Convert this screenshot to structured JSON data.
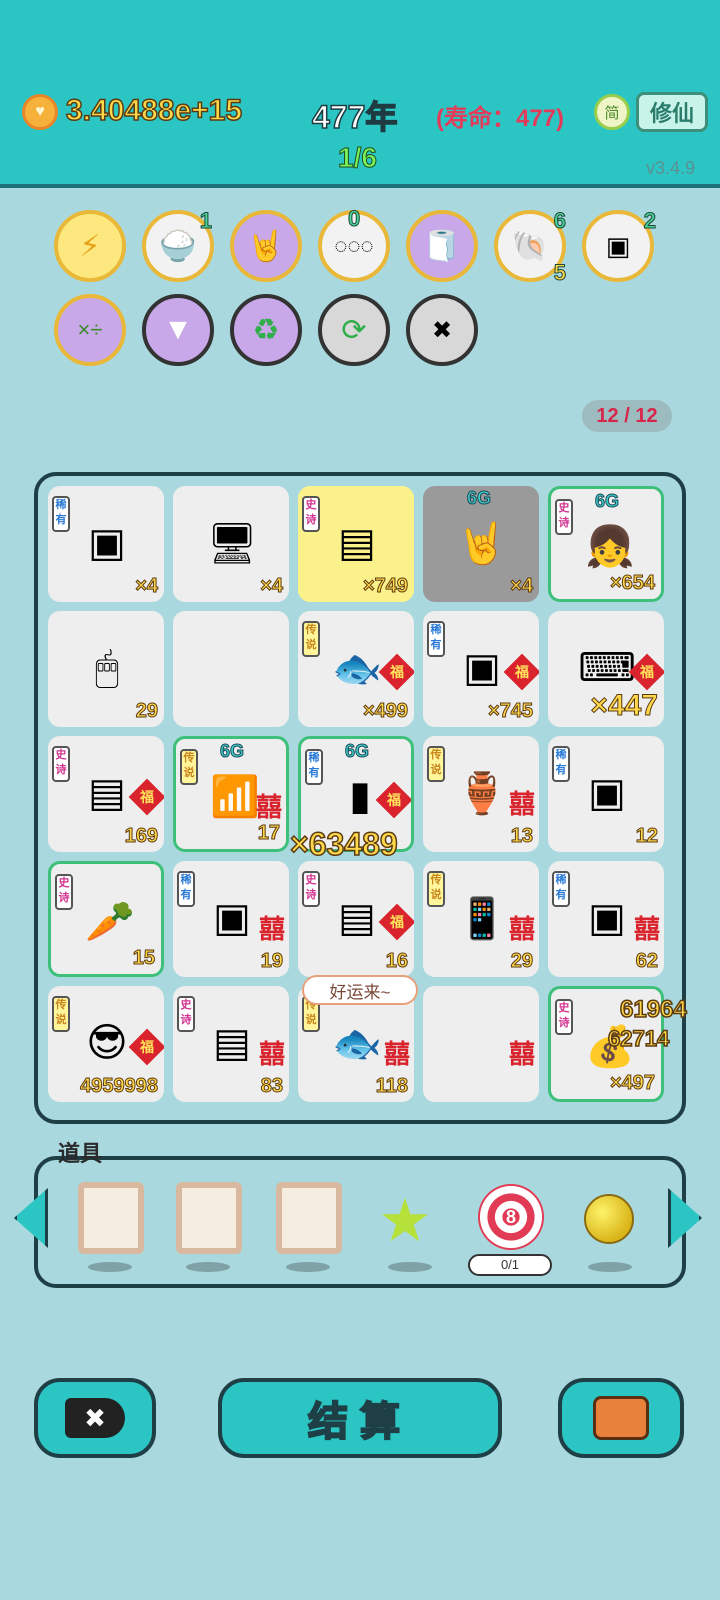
{
  "status_bar": {
    "coins": "3.40488e+15",
    "years": "477年",
    "lifespan": "(寿命：477)",
    "stage": "1/6",
    "lang_button": "简",
    "cultivate_button": "修仙",
    "version": "v3.4.9"
  },
  "skills_row1": [
    {
      "icon": "lightning-icon",
      "count": ""
    },
    {
      "icon": "rice-bowl-icon",
      "count": "1"
    },
    {
      "icon": "rock-hand-icon",
      "count": ""
    },
    {
      "icon": "egg-tray-icon",
      "count": "0"
    },
    {
      "icon": "tissue-box-icon",
      "count": ""
    },
    {
      "icon": "shell-icon",
      "count": "6",
      "count2": "5"
    },
    {
      "icon": "chip-icon",
      "count": "2"
    }
  ],
  "skills_row2": [
    {
      "icon": "math-character-icon"
    },
    {
      "icon": "pleated-skirt-icon"
    },
    {
      "icon": "recycle-icon"
    },
    {
      "icon": "refresh-icon"
    },
    {
      "icon": "delete-tag-icon"
    }
  ],
  "board_counter": "12 / 12",
  "board": [
    {
      "rarity": "稀有",
      "item": "cpu-icon",
      "value": "×4"
    },
    {
      "rarity": "",
      "item": "computer-icon",
      "value": "×4"
    },
    {
      "rarity": "史诗",
      "item": "gpu-icon",
      "value": "×749"
    },
    {
      "rarity": "",
      "item": "rock-hand-icon",
      "value": "×4",
      "badge": "6G"
    },
    {
      "rarity": "史诗",
      "item": "girl-icon",
      "value": "×654",
      "badge": "6G"
    },
    {
      "rarity": "",
      "item": "mouse-icon",
      "value": "29"
    },
    {
      "rarity": "",
      "item": "empty",
      "value": ""
    },
    {
      "rarity": "传说",
      "item": "koi-fish-icon",
      "value": "×499"
    },
    {
      "rarity": "稀有",
      "item": "cpu-icon",
      "value": "×745"
    },
    {
      "rarity": "",
      "item": "keyboard-icon",
      "value": "×447"
    },
    {
      "rarity": "史诗",
      "item": "gpu-icon",
      "value": "169"
    },
    {
      "rarity": "传说",
      "item": "wifi-icon",
      "value": "17",
      "badge": "6G"
    },
    {
      "rarity": "稀有",
      "item": "pc-tower-icon",
      "value": "",
      "badge": "6G"
    },
    {
      "rarity": "传说",
      "item": "vase-icon",
      "value": "13"
    },
    {
      "rarity": "稀有",
      "item": "cpu-icon",
      "value": "12"
    },
    {
      "rarity": "史诗",
      "item": "carrot-icon",
      "value": "15"
    },
    {
      "rarity": "稀有",
      "item": "cpu-icon",
      "value": "19"
    },
    {
      "rarity": "史诗",
      "item": "gpu-icon",
      "value": "16"
    },
    {
      "rarity": "传说",
      "item": "phone-icon",
      "value": "29"
    },
    {
      "rarity": "稀有",
      "item": "cpu-icon",
      "value": "62"
    },
    {
      "rarity": "传说",
      "item": "face-icon",
      "value": "4959998"
    },
    {
      "rarity": "史诗",
      "item": "gpu-icon",
      "value": "83"
    },
    {
      "rarity": "传说",
      "item": "koi-fish-icon",
      "value": "118"
    },
    {
      "rarity": "",
      "item": "empty",
      "value": ""
    },
    {
      "rarity": "史诗",
      "item": "gold-pile-icon",
      "value": "×497"
    }
  ],
  "floating": {
    "combo": "×63489",
    "coin_a": "61964",
    "coin_b": "62714",
    "bubble": "好运来~"
  },
  "props": {
    "label": "道具",
    "target_count": "0/1",
    "target_number": "8"
  },
  "bottom": {
    "settle": "结算"
  }
}
